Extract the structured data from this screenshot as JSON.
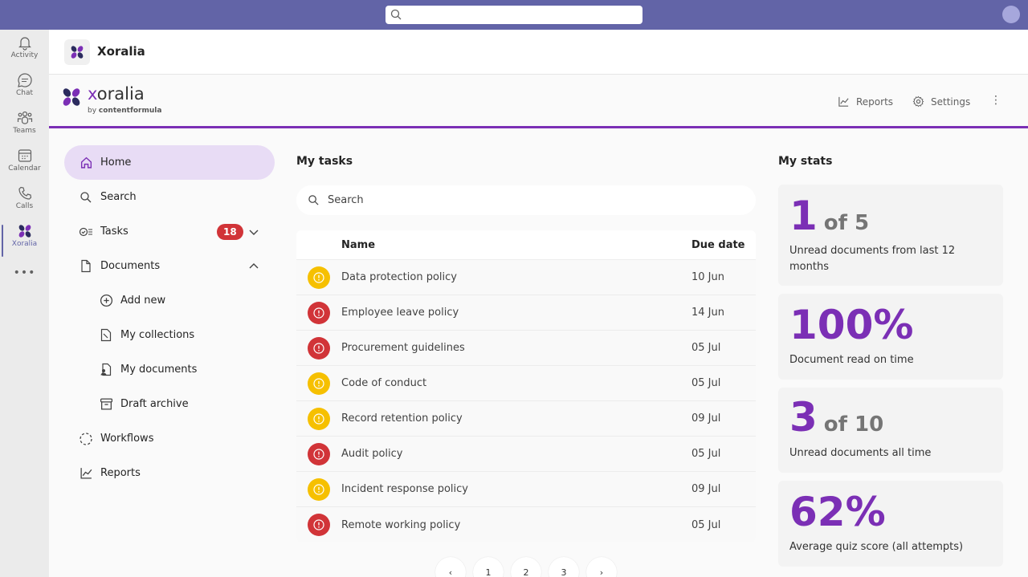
{
  "rail": {
    "items": [
      {
        "label": "Activity"
      },
      {
        "label": "Chat"
      },
      {
        "label": "Teams"
      },
      {
        "label": "Calendar"
      },
      {
        "label": "Calls"
      },
      {
        "label": "Xoralia"
      }
    ],
    "more": "•••"
  },
  "app_header": {
    "title": "Xoralia"
  },
  "brand": {
    "name_prefix": "x",
    "name_rest": "oralia",
    "sub_prefix": "by ",
    "sub_bold": "contentformula"
  },
  "header_actions": {
    "reports_label": "Reports",
    "settings_label": "Settings",
    "more": "⋮"
  },
  "nav": {
    "home": "Home",
    "search": "Search",
    "tasks": "Tasks",
    "tasks_badge": "18",
    "documents": "Documents",
    "add_new": "Add new",
    "my_collections": "My collections",
    "my_documents": "My documents",
    "draft_archive": "Draft archive",
    "workflows": "Workflows",
    "reports": "Reports"
  },
  "tasks": {
    "title": "My tasks",
    "search_placeholder": "Search",
    "columns": {
      "name": "Name",
      "due": "Due date"
    },
    "rows": [
      {
        "name": "Data protection policy",
        "due": "10 Jun",
        "status": "warning"
      },
      {
        "name": "Employee leave policy",
        "due": "14 Jun",
        "status": "overdue"
      },
      {
        "name": "Procurement guidelines",
        "due": "05 Jul",
        "status": "overdue"
      },
      {
        "name": "Code of conduct",
        "due": "05 Jul",
        "status": "warning"
      },
      {
        "name": "Record retention policy",
        "due": "09 Jul",
        "status": "warning"
      },
      {
        "name": "Audit policy",
        "due": "05 Jul",
        "status": "overdue"
      },
      {
        "name": "Incident response policy",
        "due": "09 Jul",
        "status": "warning"
      },
      {
        "name": "Remote working policy",
        "due": "05 Jul",
        "status": "overdue"
      }
    ],
    "pager": {
      "prev": "‹",
      "pages": [
        "1",
        "2",
        "3"
      ],
      "next": "›"
    }
  },
  "stats": {
    "title": "My stats",
    "cards": [
      {
        "big": "1",
        "of": "of 5",
        "desc": "Unread documents from last 12 months"
      },
      {
        "big": "100%",
        "of": "",
        "desc": "Document read on time"
      },
      {
        "big": "3",
        "of": "of 10",
        "desc": "Unread documents all time"
      },
      {
        "big": "62%",
        "of": "",
        "desc": "Average quiz score (all attempts)"
      }
    ]
  },
  "colors": {
    "accent": "#7b2fb5",
    "teams": "#6264a7",
    "warning": "#f6c000",
    "overdue": "#d13438"
  }
}
